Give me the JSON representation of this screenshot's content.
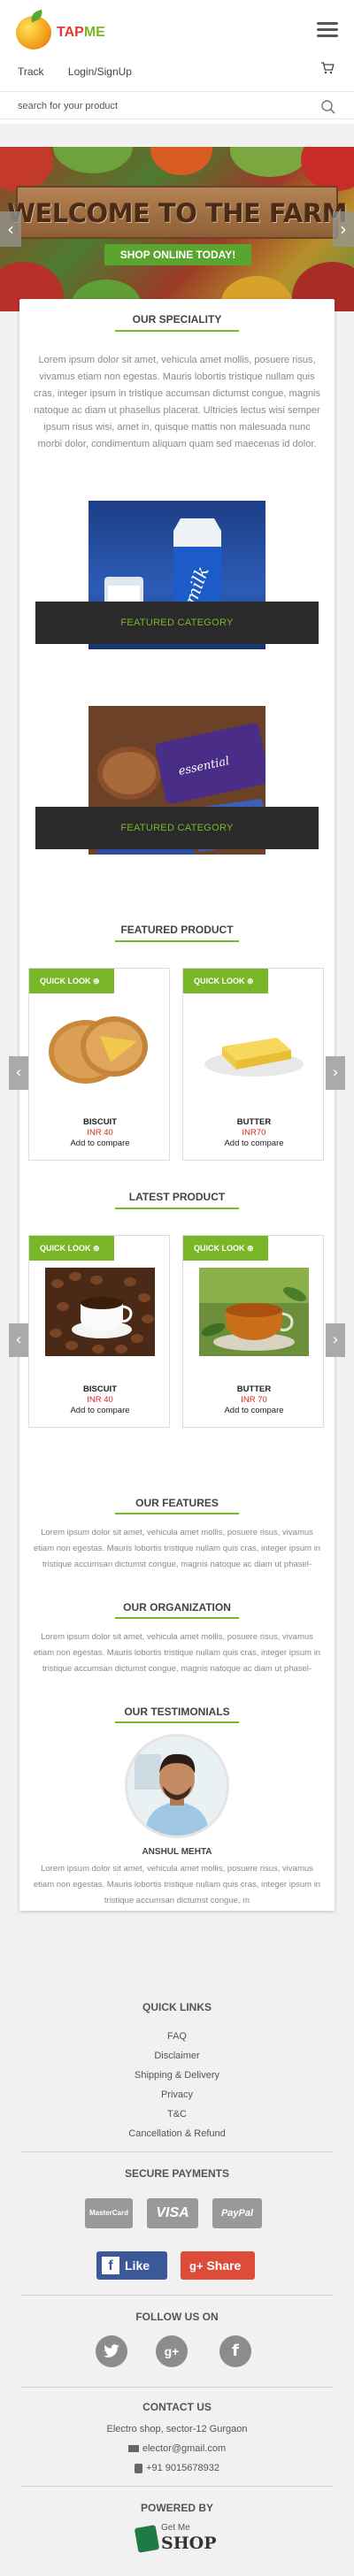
{
  "header": {
    "logo_text_a": "TAP",
    "logo_text_b": "ME",
    "menu_icon": "hamburger-icon",
    "nav": [
      "Track",
      "Login/SignUp"
    ],
    "cart_icon": "cart-icon",
    "search_placeholder": "search for your product",
    "search_icon": "search-icon"
  },
  "banner": {
    "headline": "WELCOME TO THE FARM",
    "cta": "SHOP ONLINE TODAY!",
    "prev": "‹",
    "next": "›"
  },
  "speciality": {
    "title": "OUR SPECIALITY",
    "text": "Lorem ipsum dolor sit amet, vehicula amet mollis, posuere risus, vivamus etiam non egestas. Mauris lobortis tristique nullam quis cras, integer ipsum in tristique accumsan dictumst congue, magnis natoque ac diam ut phasellus placerat. Ultricies lectus wisi semper ipsum risus wisi, amet in, quisque mattis non malesuada nunc morbi dolor, condimentum aliquam quam sed maecenas id dolor.",
    "categories": [
      {
        "label": "FEATURED CATEGORY",
        "image": "milk"
      },
      {
        "label": "FEATURED CATEGORY",
        "image": "biscuits"
      }
    ]
  },
  "featured_products": {
    "title": "FEATURED PRODUCT",
    "quick_look": "QUICK LOOK",
    "items": [
      {
        "name": "BISCUIT",
        "price": "INR 40",
        "compare": "Add to compare"
      },
      {
        "name": "BUTTER",
        "price": "INR70",
        "compare": "Add to compare"
      }
    ]
  },
  "latest_products": {
    "title": "LATEST PRODUCT",
    "quick_look": "QUICK LOOK",
    "items": [
      {
        "name": "BISCUIT",
        "price": "INR 40",
        "compare": "Add to compare"
      },
      {
        "name": "BUTTER",
        "price": "INR 70",
        "compare": "Add to compare"
      }
    ]
  },
  "features": {
    "title": "OUR FEATURES",
    "text": "Lorem ipsum dolor sit amet, vehicula amet mollis, posuere risus, vivamus etiam non egestas. Mauris lobortis tristique nullam quis cras, integer ipsum in tristique accumsan dictumst congue, magnis natoque ac diam ut phasel-"
  },
  "organization": {
    "title": "OUR ORGANIZATION",
    "text": "Lorem ipsum dolor sit amet, vehicula amet mollis, posuere risus, vivamus etiam non egestas. Mauris lobortis tristique nullam quis cras, integer ipsum in tristique accumsan dictumst congue, magnis natoque ac diam ut phasel-"
  },
  "testimonials": {
    "title": "OUR TESTIMONIALS",
    "name": "ANSHUL MEHTA",
    "text": "Lorem ipsum dolor sit amet, vehicula amet mollis, posuere risus, vivamus etiam non egestas. Mauris lobortis tristique nullam quis cras, integer ipsum in tristique accumsan dictumst congue, m"
  },
  "footer": {
    "quick_links_title": "QUICK LINKS",
    "links": [
      "FAQ",
      "Disclaimer",
      "Shipping & Delivery",
      "Privacy",
      "T&C",
      "Cancellation & Refund"
    ],
    "secure_title": "SECURE PAYMENTS",
    "payments": [
      "MasterCard",
      "VISA",
      "PayPal"
    ],
    "like_label": "Like",
    "share_label": "Share",
    "follow_title": "FOLLOW US ON",
    "social": [
      "twitter-icon",
      "google-plus-icon",
      "facebook-icon"
    ],
    "contact_title": "CONTACT US",
    "address": "Electro shop, sector-12 Gurgaon",
    "email": "elector@gmail.com",
    "phone": "+91 9015678932",
    "powered_title": "POWERED BY",
    "powered_brand_a": "Get Me",
    "powered_brand_b": "SHOP"
  },
  "colors": {
    "accent": "#7ab728",
    "price": "#d9261c",
    "like": "#3b5998",
    "share": "#dd4b39"
  }
}
